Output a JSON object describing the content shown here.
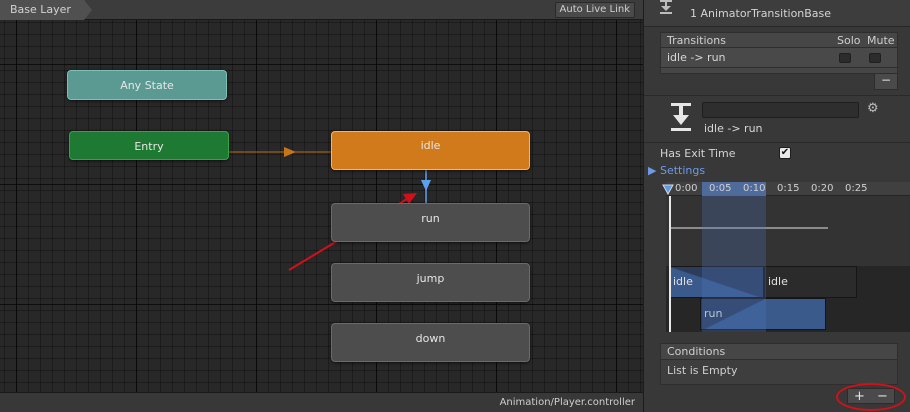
{
  "graph": {
    "breadcrumb": "Base Layer",
    "live_link_label": "Auto Live Link",
    "status_path": "Animation/Player.controller",
    "nodes": {
      "any_state": "Any State",
      "entry": "Entry",
      "idle": "idle",
      "run": "run",
      "jump": "jump",
      "down": "down"
    }
  },
  "inspector": {
    "title": "1 AnimatorTransitionBase",
    "transitions": {
      "header": "Transitions",
      "solo": "Solo",
      "mute": "Mute",
      "rows": [
        {
          "label": "idle -> run"
        }
      ],
      "remove_label": "−"
    },
    "transition": {
      "name_value": "",
      "label": "idle -> run",
      "gear_glyph": "⚙"
    },
    "has_exit_time": {
      "label": "Has Exit Time",
      "checked": true,
      "check_glyph": "✔"
    },
    "settings_label": "▶ Settings",
    "timeline": {
      "ticks": [
        "0:00",
        "0:05",
        "0:10",
        "0:15",
        "0:20",
        "0:25"
      ],
      "clips": {
        "idle_a": "idle",
        "idle_b": "idle",
        "run": "run"
      }
    },
    "conditions": {
      "header": "Conditions",
      "empty_text": "List is Empty",
      "add_label": "+",
      "remove_label": "−"
    }
  },
  "colors": {
    "idle_state": "#d07a1c",
    "entry_state": "#1e7a32",
    "any_state": "#5b9a92",
    "default_state": "#4d4d4d",
    "annotation_red": "#d0111b",
    "selection_blue": "#4e6b9b"
  }
}
